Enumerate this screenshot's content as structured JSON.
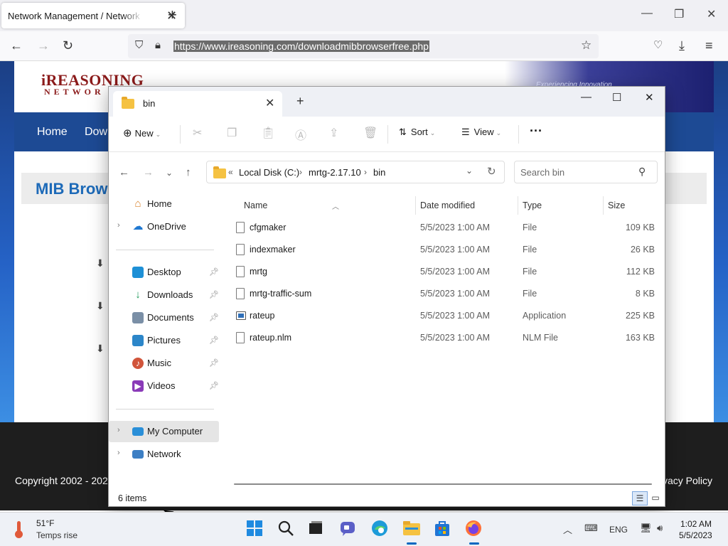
{
  "browser": {
    "tab_title": "Network Management / Network Management",
    "tab_close": "✕",
    "new_tab": "+",
    "url": "https://www.ireasoning.com/downloadmibbrowserfree.php",
    "window_controls": {
      "minimize": "—",
      "restore": "❐",
      "close": "✕"
    }
  },
  "website": {
    "logo_main": "iREASONING",
    "logo_sub": "NETWOR",
    "banner_text": "Experiencing Innovation",
    "nav": [
      "Home",
      "Dow"
    ],
    "section_title": "MIB Brow",
    "footer_copyright": "Copyright 2002 - 202",
    "footer_privacy": "vacy Policy"
  },
  "explorer": {
    "tab_label": "bin",
    "window_controls": {
      "minimize": "—",
      "maximize": "☐",
      "close": "✕"
    },
    "toolbar": {
      "new": "New",
      "sort": "Sort",
      "view": "View",
      "more": "···"
    },
    "breadcrumb_overflow": "«",
    "breadcrumb": [
      "Local Disk (C:)",
      "mrtg-2.17.10",
      "bin"
    ],
    "search_placeholder": "Search bin",
    "sidebar": {
      "top": [
        {
          "label": "Home",
          "icon": "home-icon",
          "expander": false
        },
        {
          "label": "OneDrive",
          "icon": "cloud-icon",
          "expander": true
        }
      ],
      "quick": [
        {
          "label": "Desktop",
          "icon": "desktop-icon",
          "color": "#1e90d6"
        },
        {
          "label": "Downloads",
          "icon": "download-icon",
          "color": "#1f9b5a"
        },
        {
          "label": "Documents",
          "icon": "document-icon",
          "color": "#7a8fa6"
        },
        {
          "label": "Pictures",
          "icon": "picture-icon",
          "color": "#2c86c9"
        },
        {
          "label": "Music",
          "icon": "music-icon",
          "color": "#d1553b"
        },
        {
          "label": "Videos",
          "icon": "video-icon",
          "color": "#8a3ab8"
        }
      ],
      "bottom": [
        {
          "label": "My Computer",
          "icon": "computer-icon",
          "selected": true
        },
        {
          "label": "Network",
          "icon": "network-icon",
          "selected": false
        }
      ]
    },
    "columns": [
      "Name",
      "Date modified",
      "Type",
      "Size"
    ],
    "files": [
      {
        "name": "cfgmaker",
        "date": "5/5/2023 1:00 AM",
        "type": "File",
        "size": "109 KB",
        "icon": "file-icon"
      },
      {
        "name": "indexmaker",
        "date": "5/5/2023 1:00 AM",
        "type": "File",
        "size": "26 KB",
        "icon": "file-icon"
      },
      {
        "name": "mrtg",
        "date": "5/5/2023 1:00 AM",
        "type": "File",
        "size": "112 KB",
        "icon": "file-icon"
      },
      {
        "name": "mrtg-traffic-sum",
        "date": "5/5/2023 1:00 AM",
        "type": "File",
        "size": "8 KB",
        "icon": "file-icon"
      },
      {
        "name": "rateup",
        "date": "5/5/2023 1:00 AM",
        "type": "Application",
        "size": "225 KB",
        "icon": "application-icon"
      },
      {
        "name": "rateup.nlm",
        "date": "5/5/2023 1:00 AM",
        "type": "NLM File",
        "size": "163 KB",
        "icon": "file-icon"
      }
    ],
    "status": "6 items"
  },
  "taskbar": {
    "weather_temp": "51°F",
    "weather_desc": "Temps rise",
    "language": "ENG",
    "time": "1:02 AM",
    "date": "5/5/2023"
  },
  "colors": {
    "accent": "#0067c0",
    "folder": "#f5c242",
    "site_nav": "#1d4a94"
  }
}
